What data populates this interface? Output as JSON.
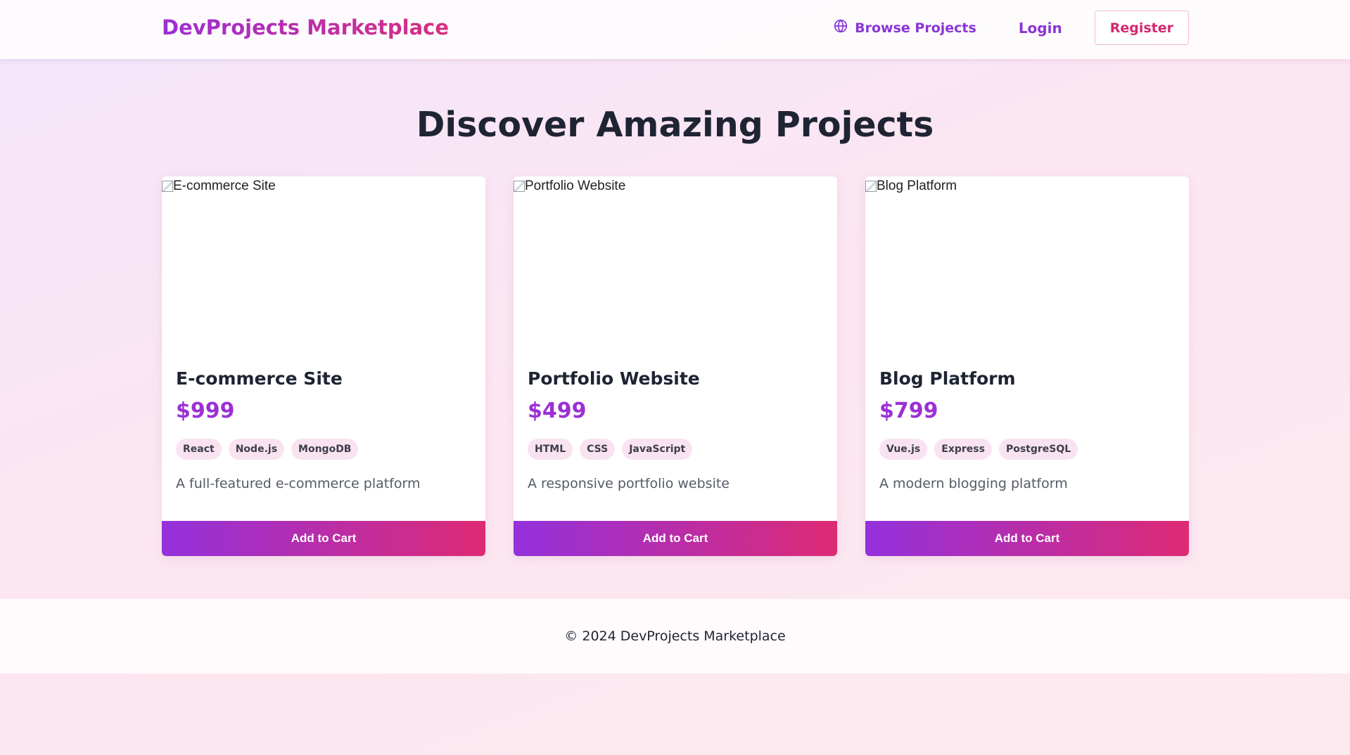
{
  "header": {
    "brand": "DevProjects Marketplace",
    "nav": {
      "browse_label": "Browse Projects",
      "browse_icon": "globe-icon",
      "login_label": "Login",
      "register_label": "Register"
    }
  },
  "main": {
    "title": "Discover Amazing Projects",
    "projects": [
      {
        "image_alt": "E-commerce Site",
        "title": "E-commerce Site",
        "price": "$999",
        "tags": [
          "React",
          "Node.js",
          "MongoDB"
        ],
        "description": "A full-featured e-commerce platform",
        "button_label": "Add to Cart"
      },
      {
        "image_alt": "Portfolio Website",
        "title": "Portfolio Website",
        "price": "$499",
        "tags": [
          "HTML",
          "CSS",
          "JavaScript"
        ],
        "description": "A responsive portfolio website",
        "button_label": "Add to Cart"
      },
      {
        "image_alt": "Blog Platform",
        "title": "Blog Platform",
        "price": "$799",
        "tags": [
          "Vue.js",
          "Express",
          "PostgreSQL"
        ],
        "description": "A modern blogging platform",
        "button_label": "Add to Cart"
      }
    ]
  },
  "footer": {
    "text": "© 2024 DevProjects Marketplace"
  },
  "colors": {
    "brand_purple": "#9b30d5",
    "brand_pink": "#d8307d",
    "text_dark": "#1f2433"
  }
}
